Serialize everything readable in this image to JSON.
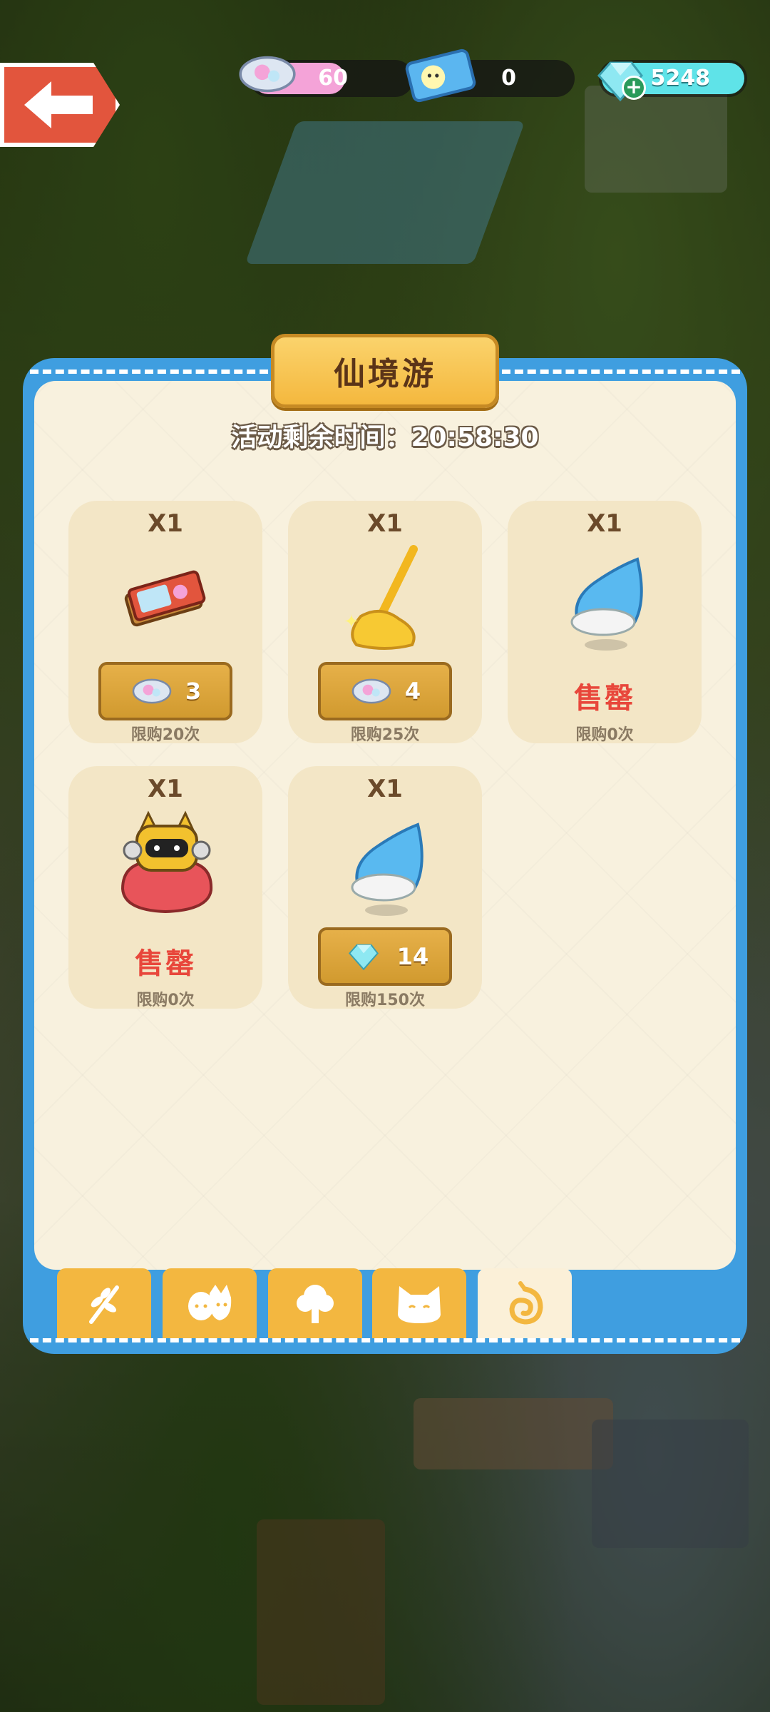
{
  "topbar": {
    "back_icon": "left-arrow-icon",
    "resources": [
      {
        "icon": "candy-icon",
        "value": "60",
        "fill": "#f4a3d8"
      },
      {
        "icon": "ticket-icon",
        "value": "0",
        "fill": "transparent"
      },
      {
        "icon": "diamond-icon",
        "value": "5248",
        "fill": "#5fe3e8",
        "has_add": true
      }
    ]
  },
  "panel": {
    "title": "仙境游",
    "timer_label": "活动剩余时间：",
    "timer_value": "20:58:30"
  },
  "shop": {
    "items": [
      {
        "qty": "X1",
        "icon": "ticket-bundle-icon",
        "price": "3",
        "currency_icon": "candy-icon",
        "limit": "限购20次",
        "sold_out": false
      },
      {
        "qty": "X1",
        "icon": "broom-icon",
        "price": "4",
        "currency_icon": "candy-icon",
        "limit": "限购25次",
        "sold_out": false
      },
      {
        "qty": "X1",
        "icon": "blue-bell-icon",
        "sold_out_text": "售罄",
        "limit": "限购0次",
        "sold_out": true
      },
      {
        "qty": "X1",
        "icon": "robot-cat-cushion-icon",
        "sold_out_text": "售罄",
        "limit": "限购0次",
        "sold_out": true
      },
      {
        "qty": "X1",
        "icon": "blue-bell-icon",
        "price": "14",
        "currency_icon": "diamond-icon",
        "limit": "限购150次",
        "sold_out": false
      }
    ]
  },
  "tabs": [
    {
      "icon": "leaf-branch-icon",
      "active": false
    },
    {
      "icon": "pet-faces-icon",
      "active": false
    },
    {
      "icon": "tree-icon",
      "active": false
    },
    {
      "icon": "cat-face-icon",
      "active": false
    },
    {
      "icon": "swirl-icon",
      "active": true
    }
  ],
  "colors": {
    "panel_blue": "#3f9ee0",
    "card": "#f3e6c6",
    "sold_out": "#e8473b",
    "tab": "#f3b740"
  }
}
